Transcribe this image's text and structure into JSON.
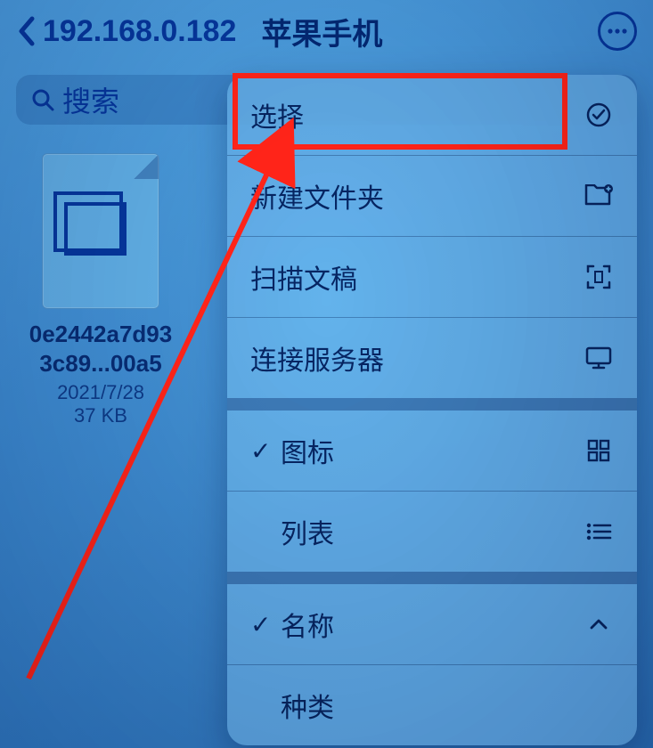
{
  "navbar": {
    "back_label": "192.168.0.182",
    "title": "苹果手机"
  },
  "search": {
    "placeholder": "搜索"
  },
  "file": {
    "name_line1": "0e2442a7d93",
    "name_line2": "3c89...00a5",
    "date": "2021/7/28",
    "size": "37 KB"
  },
  "menu": {
    "select": "选择",
    "new_folder": "新建文件夹",
    "scan_docs": "扫描文稿",
    "connect_server": "连接服务器",
    "view_icon": "图标",
    "view_list": "列表",
    "sort_name": "名称",
    "sort_kind": "种类"
  }
}
